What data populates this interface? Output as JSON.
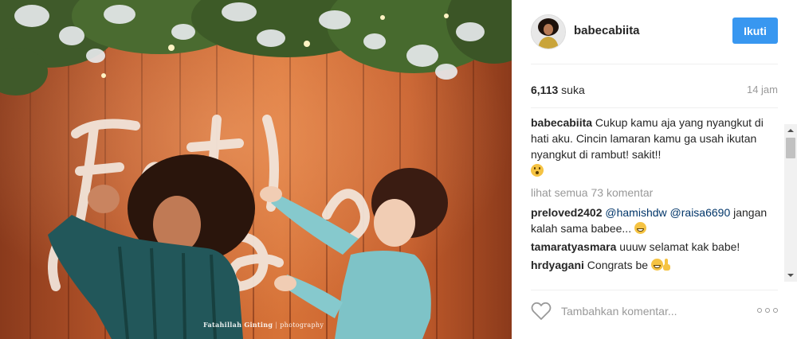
{
  "photo": {
    "alt_icon": "photo-image",
    "credit_name": "Fatahillah Ginting",
    "credit_suffix": "photography"
  },
  "header": {
    "username": "babecabiita",
    "follow_label": "Ikuti",
    "avatar_icon": "user-avatar"
  },
  "stats": {
    "likes_count": "6,113",
    "likes_label": "suka",
    "timestamp": "14 jam"
  },
  "caption": {
    "user": "babecabiita",
    "text": "Cukup kamu aja yang nyangkut di hati aku. Cincin lamaran kamu ga usah ikutan nyangkut di rambut! sakit!!",
    "emoji": "shocked-face-emoji"
  },
  "view_all_label": "lihat semua 73 komentar",
  "comments": [
    {
      "user": "preloved2402",
      "mentions": [
        "@hamishdw",
        "@raisa6690"
      ],
      "text": "jangan kalah sama babee...",
      "emoji": "grinning-face-emoji"
    },
    {
      "user": "tamaratyasmara",
      "text": "uuuw selamat kak babe!"
    },
    {
      "user": "hrdyagani",
      "text": "Congrats be",
      "emoji": "smile-ok-emoji"
    }
  ],
  "composer": {
    "placeholder": "Tambahkan komentar...",
    "like_icon": "heart-outline",
    "more_icon": "more-options"
  },
  "colors": {
    "accent": "#3897f0",
    "text": "#262626",
    "muted": "#999999",
    "mention": "#003569"
  }
}
